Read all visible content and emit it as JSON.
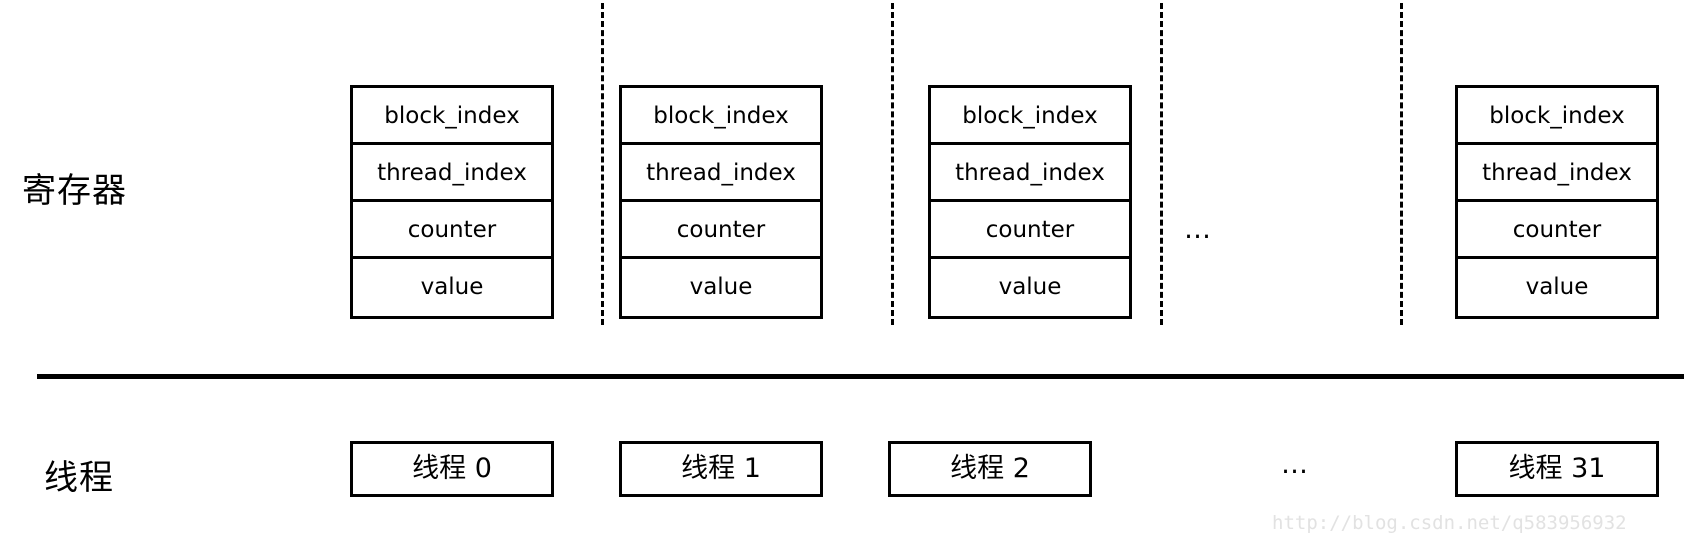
{
  "labels": {
    "registers": "寄存器",
    "threads": "线程"
  },
  "register_fields": [
    "block_index",
    "thread_index",
    "counter",
    "value"
  ],
  "register_columns": [
    {
      "fields": [
        "block_index",
        "thread_index",
        "counter",
        "value"
      ]
    },
    {
      "fields": [
        "block_index",
        "thread_index",
        "counter",
        "value"
      ]
    },
    {
      "fields": [
        "block_index",
        "thread_index",
        "counter",
        "value"
      ]
    },
    {
      "fields": [
        "block_index",
        "thread_index",
        "counter",
        "value"
      ]
    }
  ],
  "threads": [
    {
      "label": "线程 0"
    },
    {
      "label": "线程 1"
    },
    {
      "label": "线程 2"
    },
    {
      "label": "线程 31"
    }
  ],
  "ellipsis": {
    "registers": "…",
    "threads": "…"
  },
  "watermark": "http://blog.csdn.net/q583956932",
  "colors": {
    "stroke": "#000000",
    "background": "#ffffff",
    "watermark": "#e2e2e2"
  }
}
